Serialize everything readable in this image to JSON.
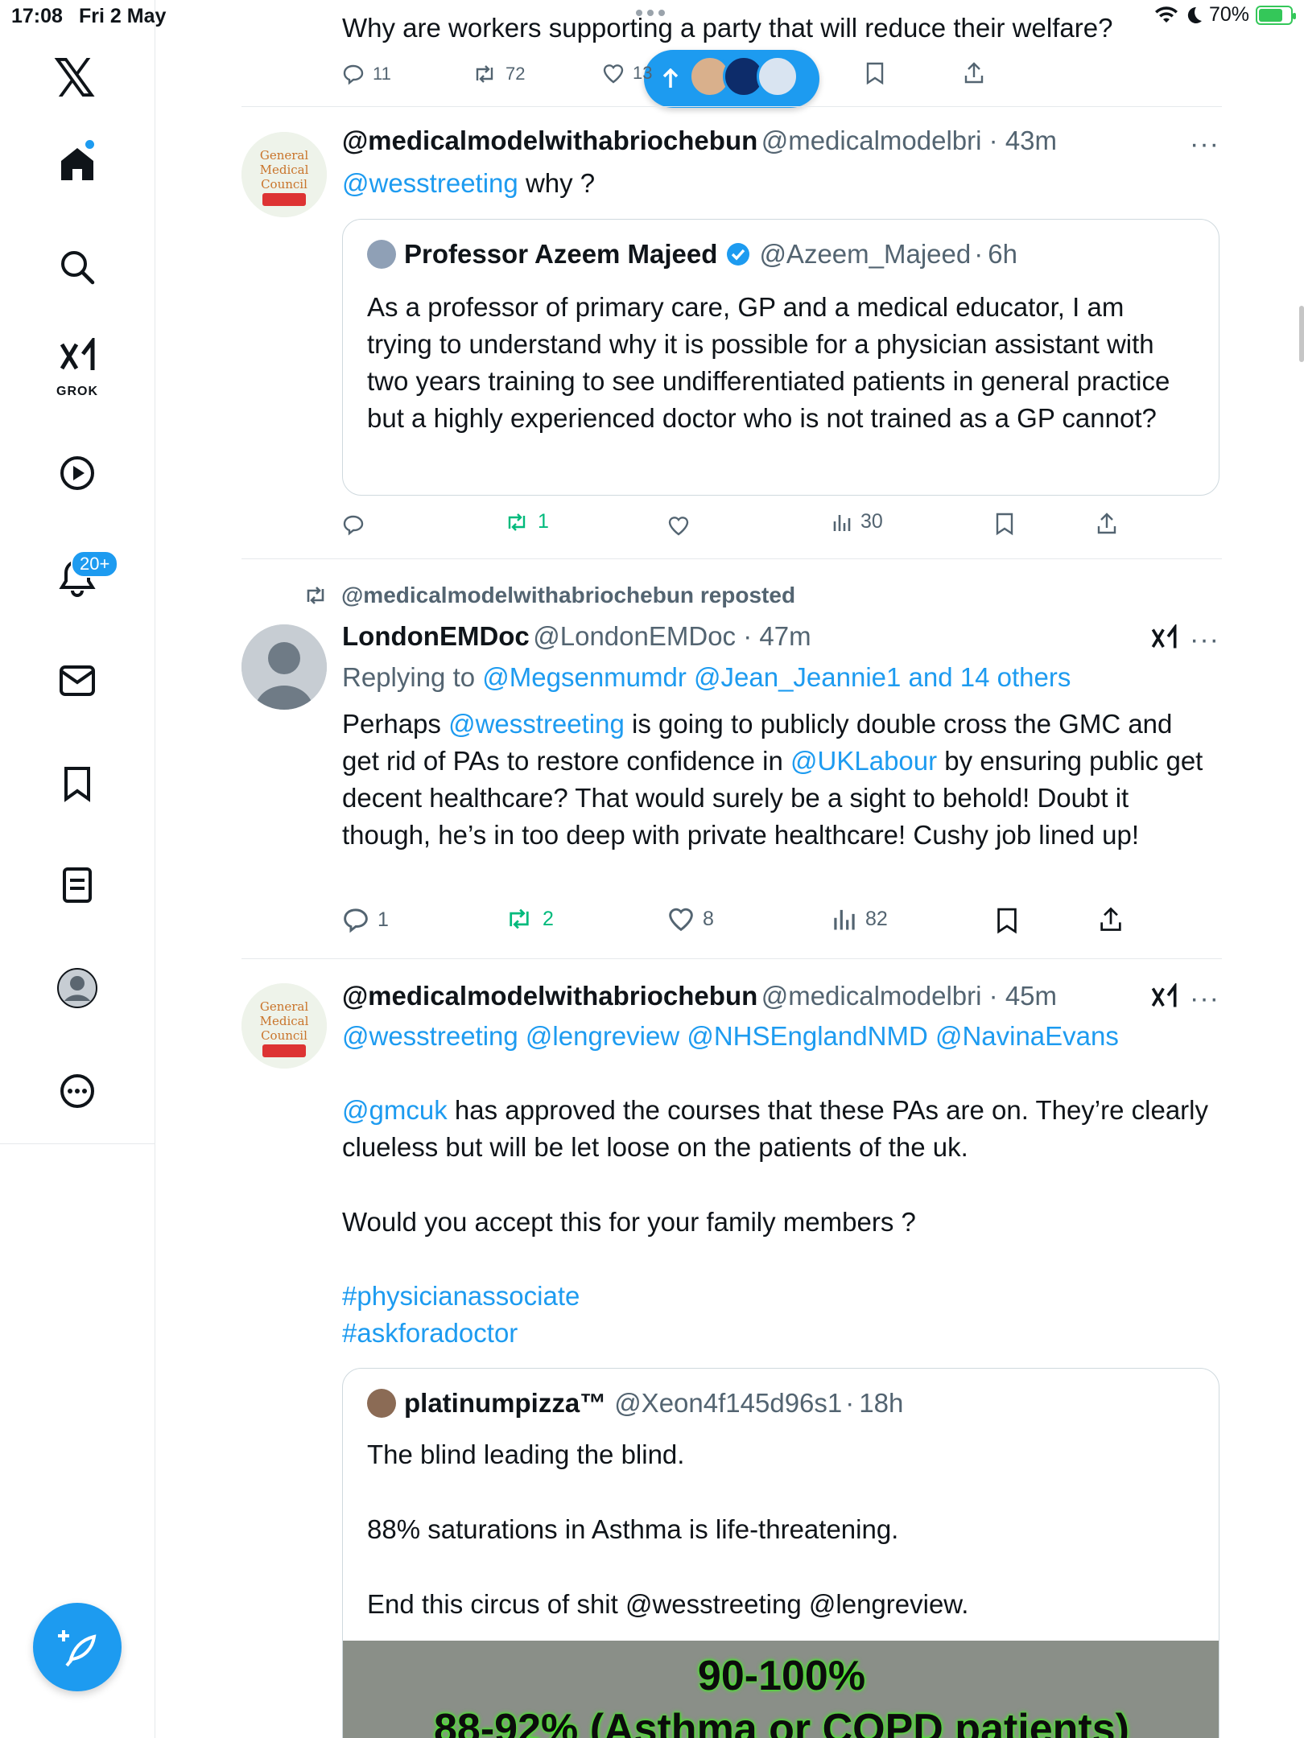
{
  "status": {
    "time": "17:08",
    "date": "Fri 2 May",
    "battery": "70%",
    "battery_level": 0.7
  },
  "sidebar": {
    "items": [
      {
        "name": "x-logo"
      },
      {
        "name": "home"
      },
      {
        "name": "search"
      },
      {
        "name": "grok",
        "label": "GROK"
      },
      {
        "name": "video"
      },
      {
        "name": "notifications",
        "badge": "20+"
      },
      {
        "name": "messages"
      },
      {
        "name": "bookmarks"
      },
      {
        "name": "lists"
      },
      {
        "name": "profile"
      },
      {
        "name": "more"
      }
    ]
  },
  "top_tweet": {
    "text": "Why are workers supporting a party that will reduce their welfare?",
    "replies": "11",
    "reposts": "72",
    "likes": "13"
  },
  "tweet1": {
    "name": "@medicalmodelwithabriochebun",
    "handle": "@medicalmodelbri",
    "time": "43m",
    "mention": "@wesstreeting",
    "text": "why ?",
    "quote": {
      "name": "Professor Azeem Majeed",
      "handle": "@Azeem_Majeed",
      "time": "6h",
      "text": "As a professor of primary care, GP and a medical educator, I am trying to understand why it is possible for a physician assistant with two years training to see undifferentiated patients in general practice but a highly experienced doctor who is not trained as a GP cannot?"
    },
    "reposts": "1",
    "views": "30"
  },
  "tweet2": {
    "repost_label": "@medicalmodelwithabriochebun reposted",
    "name": "LondonEMDoc",
    "handle": "@LondonEMDoc",
    "time": "47m",
    "replying_prefix": "Replying to",
    "replying_to": "@Megsenmumdr @Jean_Jeannie1 and 14 others",
    "text_parts": [
      "Perhaps ",
      "@wesstreeting",
      " is going to publicly double cross the GMC and get rid of PAs to restore confidence in ",
      "@UKLabour",
      " by ensuring public get decent healthcare? That would surely be a sight to behold! Doubt it though, he’s in too deep with private healthcare! Cushy job lined up!"
    ],
    "replies": "1",
    "reposts": "2",
    "likes": "8",
    "views": "82"
  },
  "tweet3": {
    "name": "@medicalmodelwithabriochebun",
    "handle": "@medicalmodelbri",
    "time": "45m",
    "mentions": "@wesstreeting @lengreview @NHSEnglandNMD @NavinaEvans",
    "gmc_mention": "@gmcuk",
    "text1": " has approved the courses that these PAs are on. They’re clearly clueless but will be let loose on the patients of the uk.",
    "text2": "Would you accept this for your family members ?",
    "hashtag1": "#physicianassociate",
    "hashtag2": "#askforadoctor",
    "quote": {
      "name": "platinumpizza™",
      "handle": "@Xeon4f145d96s1",
      "time": "18h",
      "line1": "The blind leading the blind.",
      "line2": "88% saturations in Asthma is life-threatening.",
      "line3": "End this circus of shit @wesstreeting @lengreview.",
      "media_line1": "90-100%",
      "media_line2": "88-92% (Asthma or COPD patients)"
    }
  },
  "colors": {
    "accent": "#1d9bf0",
    "text": "#0f1419",
    "muted": "#536471",
    "repost_green": "#00ba7c"
  }
}
